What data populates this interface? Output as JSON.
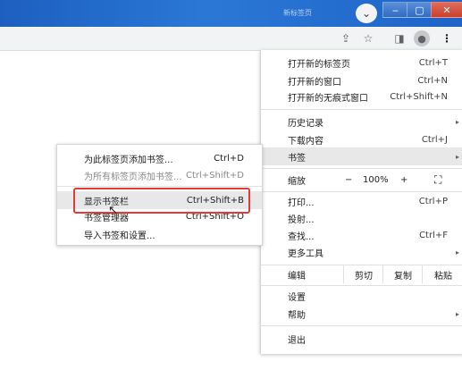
{
  "window": {
    "tab_title": "新标签页",
    "profile_icon": "chevron-down-icon",
    "minimize": "‒",
    "maximize": "▢",
    "close": "✕"
  },
  "toolbar": {
    "share_icon": "⇪",
    "star_icon": "☆",
    "sidepanel_icon": "◨",
    "avatar_icon": "●",
    "more_icon": "⋮"
  },
  "menu": {
    "new_tab": {
      "label": "打开新的标签页",
      "shortcut": "Ctrl+T"
    },
    "new_window": {
      "label": "打开新的窗口",
      "shortcut": "Ctrl+N"
    },
    "new_incognito": {
      "label": "打开新的无痕式窗口",
      "shortcut": "Ctrl+Shift+N"
    },
    "history": {
      "label": "历史记录"
    },
    "downloads": {
      "label": "下载内容",
      "shortcut": "Ctrl+J"
    },
    "bookmarks": {
      "label": "书签"
    },
    "zoom": {
      "label": "缩放",
      "minus": "−",
      "value": "100%",
      "plus": "+",
      "fullscreen": "⛶"
    },
    "print": {
      "label": "打印...",
      "shortcut": "Ctrl+P"
    },
    "cast": {
      "label": "投射..."
    },
    "find": {
      "label": "查找...",
      "shortcut": "Ctrl+F"
    },
    "more_tools": {
      "label": "更多工具"
    },
    "edit": {
      "label": "编辑",
      "cut": "剪切",
      "copy": "复制",
      "paste": "粘贴"
    },
    "settings": {
      "label": "设置"
    },
    "help": {
      "label": "帮助"
    },
    "exit": {
      "label": "退出"
    },
    "arrow": "▸"
  },
  "submenu": {
    "add_bookmark": {
      "label": "为此标签页添加书签...",
      "shortcut": "Ctrl+D"
    },
    "add_all": {
      "label": "为所有标签页添加书签...",
      "shortcut": "Ctrl+Shift+D"
    },
    "show_bar": {
      "label": "显示书签栏",
      "shortcut": "Ctrl+Shift+B"
    },
    "manager": {
      "label": "书签管理器",
      "shortcut": "Ctrl+Shift+O"
    },
    "import": {
      "label": "导入书签和设置..."
    }
  },
  "annotation_color": "#e53935"
}
